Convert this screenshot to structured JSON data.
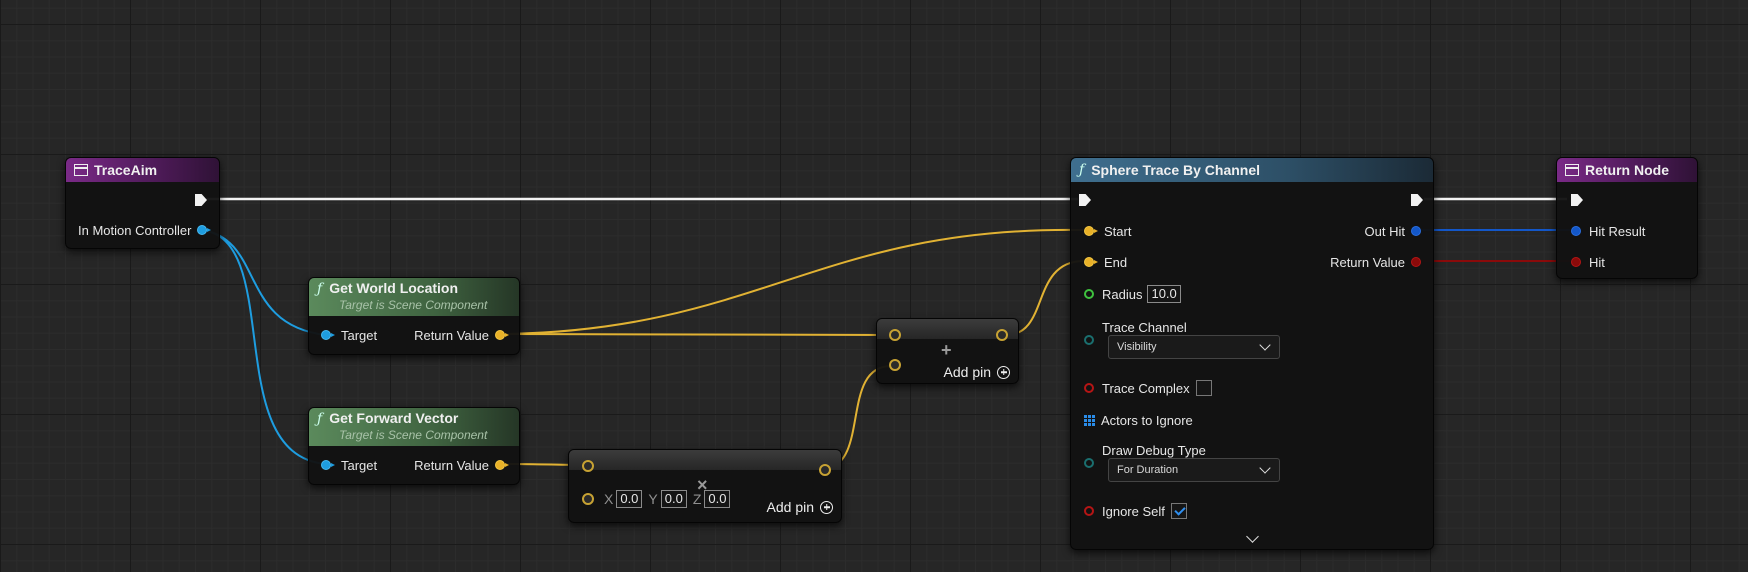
{
  "colors": {
    "exec_wire": "#f2f2f2",
    "vector_wire": "#e1b233",
    "object_wire": "#1e9de0",
    "struct_wire": "#1357c9",
    "bool_wire": "#8b0a0a",
    "background": "#262626"
  },
  "trace_aim": {
    "title": "TraceAim",
    "pin_label": "In Motion Controller",
    "icon": "function-entry-icon"
  },
  "get_world_location": {
    "title": "Get World Location",
    "subtitle": "Target is Scene Component",
    "input_label": "Target",
    "output_label": "Return Value"
  },
  "get_forward_vector": {
    "title": "Get Forward Vector",
    "subtitle": "Target is Scene Component",
    "input_label": "Target",
    "output_label": "Return Value"
  },
  "multiply_node": {
    "symbol": "×",
    "x_label": "X",
    "x_value": "0.0",
    "y_label": "Y",
    "y_value": "0.0",
    "z_label": "Z",
    "z_value": "0.0",
    "add_pin_label": "Add pin"
  },
  "add_node": {
    "symbol": "+",
    "add_pin_label": "Add pin"
  },
  "sphere_trace": {
    "title": "Sphere Trace By Channel",
    "start_label": "Start",
    "end_label": "End",
    "radius_label": "Radius",
    "radius_value": "10.0",
    "trace_channel_label": "Trace Channel",
    "trace_channel_value": "Visibility",
    "trace_complex_label": "Trace Complex",
    "trace_complex_checked": false,
    "actors_to_ignore_label": "Actors to Ignore",
    "draw_debug_type_label": "Draw Debug Type",
    "draw_debug_type_value": "For Duration",
    "ignore_self_label": "Ignore Self",
    "ignore_self_checked": true,
    "out_hit_label": "Out Hit",
    "return_value_label": "Return Value"
  },
  "return_node": {
    "title": "Return Node",
    "hit_result_label": "Hit Result",
    "hit_label": "Hit"
  }
}
